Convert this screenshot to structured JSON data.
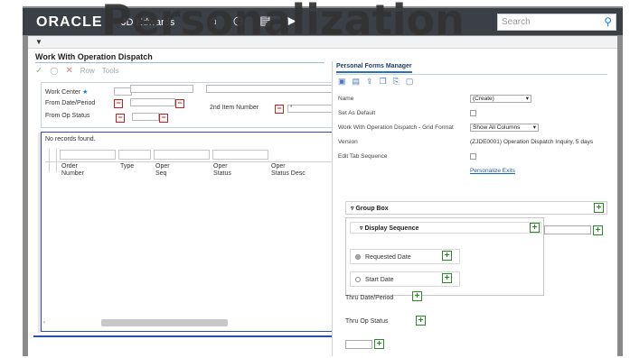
{
  "header": {
    "brand": "ORACLE",
    "product": "JD Edwards",
    "overlay_title": "Personalization",
    "search_placeholder": "Search"
  },
  "form": {
    "title": "Work With Operation Dispatch",
    "toolbar": {
      "ok": "✓",
      "find": "◯",
      "cancel": "✕",
      "row": "Row",
      "tools": "Tools"
    }
  },
  "query": {
    "work_center_label": "Work Center",
    "from_date_label": "From Date/Period",
    "from_op_status_label": "From Op Status",
    "second_item_label": "2nd Item Number",
    "second_item_value": "*"
  },
  "grid": {
    "no_records": "No records found.",
    "columns": [
      {
        "line1": "Order",
        "line2": "Number"
      },
      {
        "line1": "Type",
        "line2": ""
      },
      {
        "line1": "Oper",
        "line2": "Seq"
      },
      {
        "line1": "Oper",
        "line2": "Status"
      },
      {
        "line1": "Oper",
        "line2": "Status Desc"
      }
    ]
  },
  "pfm": {
    "tab": "Personal Forms Manager",
    "name_label": "Name",
    "name_value": "(Create)",
    "default_label": "Set As Default",
    "grid_format_label": "Work With Operation Dispatch - Grid Format",
    "grid_format_value": "Show All Columns",
    "version_label": "Version",
    "version_value": "(ZJDE0001) Operation Dispatch Inquiry, 5 days",
    "edit_tab_label": "Edit Tab Sequence",
    "personalize_exits": "Personalize Exits",
    "group_box": "Group Box",
    "display_sequence": "Display Sequence",
    "requested_date": "Requested Date",
    "start_date": "Start Date",
    "thru_date": "Thru Date/Period",
    "thru_op_status": "Thru Op Status"
  }
}
